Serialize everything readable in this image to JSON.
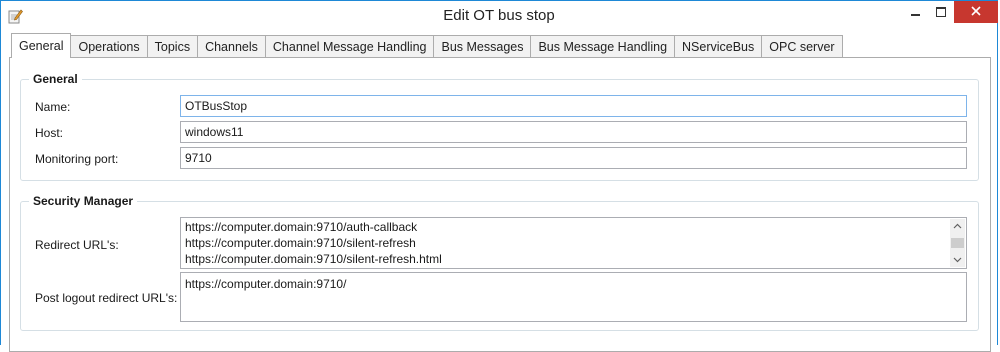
{
  "window": {
    "title": "Edit OT bus stop",
    "icon": "edit-document-icon",
    "controls": {
      "minimize": "minimize-icon",
      "maximize": "maximize-icon",
      "close": "close-icon"
    },
    "colors": {
      "border": "#1e88d6",
      "close_bg": "#c7372f",
      "field_border": "#abadb3",
      "focus_border": "#7eb4ea"
    }
  },
  "tabs": [
    {
      "label": "General",
      "active": true
    },
    {
      "label": "Operations",
      "active": false
    },
    {
      "label": "Topics",
      "active": false
    },
    {
      "label": "Channels",
      "active": false
    },
    {
      "label": "Channel Message Handling",
      "active": false
    },
    {
      "label": "Bus Messages",
      "active": false
    },
    {
      "label": "Bus Message Handling",
      "active": false
    },
    {
      "label": "NServiceBus",
      "active": false
    },
    {
      "label": "OPC server",
      "active": false
    }
  ],
  "general": {
    "legend": "General",
    "name_label": "Name:",
    "name_value": "OTBusStop",
    "host_label": "Host:",
    "host_value": "windows11",
    "port_label": "Monitoring port:",
    "port_value": "9710"
  },
  "security": {
    "legend": "Security Manager",
    "redirect_label": "Redirect URL's:",
    "redirect_urls": [
      "https://computer.domain:9710/auth-callback",
      "https://computer.domain:9710/silent-refresh",
      "https://computer.domain:9710/silent-refresh.html"
    ],
    "post_logout_label": "Post logout redirect URL's:",
    "post_logout_urls": [
      "https://computer.domain:9710/"
    ]
  }
}
